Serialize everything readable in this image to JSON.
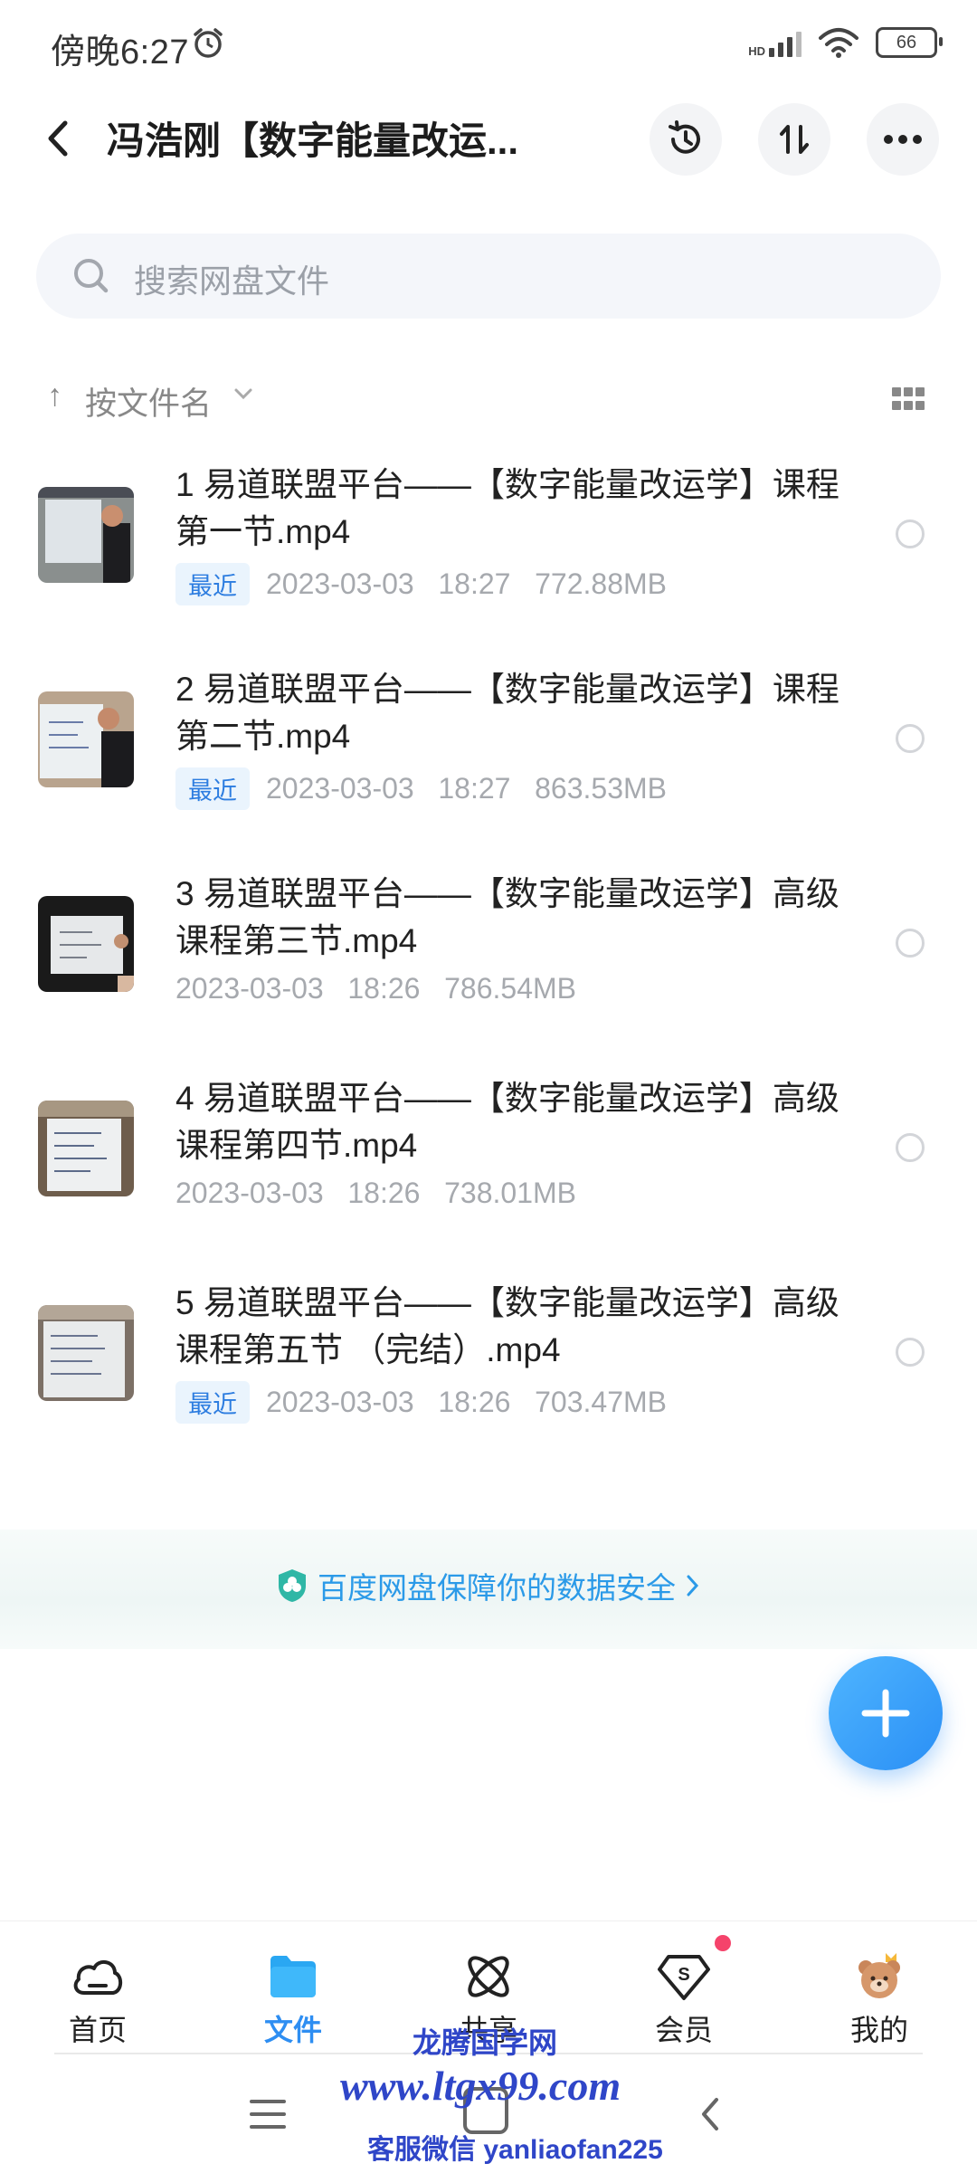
{
  "status_bar": {
    "time": "傍晚6:27",
    "battery": "66",
    "network_label": "HD"
  },
  "header": {
    "title": "冯浩刚【数字能量改运..."
  },
  "search": {
    "placeholder": "搜索网盘文件"
  },
  "sort": {
    "label": "按文件名"
  },
  "files": [
    {
      "name": "1 易道联盟平台——【数字能量改运学】课程第一节.mp4",
      "badge": "最近",
      "date": "2023-03-03",
      "time": "18:27",
      "size": "772.88MB"
    },
    {
      "name": "2 易道联盟平台——【数字能量改运学】课程第二节.mp4",
      "badge": "最近",
      "date": "2023-03-03",
      "time": "18:27",
      "size": "863.53MB"
    },
    {
      "name": "3 易道联盟平台——【数字能量改运学】高级课程第三节.mp4",
      "badge": "",
      "date": "2023-03-03",
      "time": "18:26",
      "size": "786.54MB"
    },
    {
      "name": "4 易道联盟平台——【数字能量改运学】高级课程第四节.mp4",
      "badge": "",
      "date": "2023-03-03",
      "time": "18:26",
      "size": "738.01MB"
    },
    {
      "name": "5 易道联盟平台——【数字能量改运学】高级课程第五节 （完结）.mp4",
      "badge": "最近",
      "date": "2023-03-03",
      "time": "18:26",
      "size": "703.47MB"
    }
  ],
  "safety": {
    "text": "百度网盘保障你的数据安全"
  },
  "bottom_nav": [
    {
      "label": "首页",
      "icon": "cloud-icon"
    },
    {
      "label": "文件",
      "icon": "folder-icon",
      "active": true
    },
    {
      "label": "共享",
      "icon": "atom-icon"
    },
    {
      "label": "会员",
      "icon": "vip-diamond-icon"
    },
    {
      "label": "我的",
      "icon": "bear-avatar-icon"
    }
  ],
  "watermark": {
    "line1": "龙腾国学网",
    "line2": "www.ltgx99.com",
    "line3": "客服微信 yanliaofan225"
  },
  "colors": {
    "accent": "#2e8ef2",
    "badge_bg": "#eaf4fd",
    "badge_text": "#2d7de0",
    "watermark": "#2f46c8",
    "notification_dot": "#f5436b"
  }
}
